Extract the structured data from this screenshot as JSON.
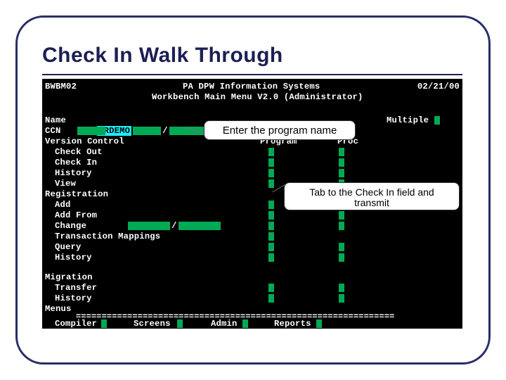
{
  "slide": {
    "title": "Check In Walk Through"
  },
  "callouts": {
    "c1": "Enter the program name",
    "c2": "Tab to the Check In field and transmit"
  },
  "terminal": {
    "screen_id": "BWBM02",
    "header1": "PA DPW Information Systems",
    "header2": "Workbench Main Menu V2.0 (Administrator)",
    "date": "02/21/00",
    "name_label": "Name",
    "name_value": "PRDEMO",
    "ccn_label": "CCN",
    "multiple_label": "Multiple",
    "section_version": "Version Control",
    "col_program": "Program",
    "col_proc": "Proc",
    "vc_items": [
      "Check Out",
      "Check In",
      "History",
      "View"
    ],
    "section_reg": "Registration",
    "reg_items": [
      "Add",
      "Add From",
      "Change",
      "Transaction Mappings",
      "Query",
      "History"
    ],
    "section_mig": "Migration",
    "mig_items": [
      "Transfer",
      "History"
    ],
    "menus_label": "Menus",
    "bottom_menu": [
      "Compiler",
      "Screens",
      "Admin",
      "Reports"
    ]
  }
}
